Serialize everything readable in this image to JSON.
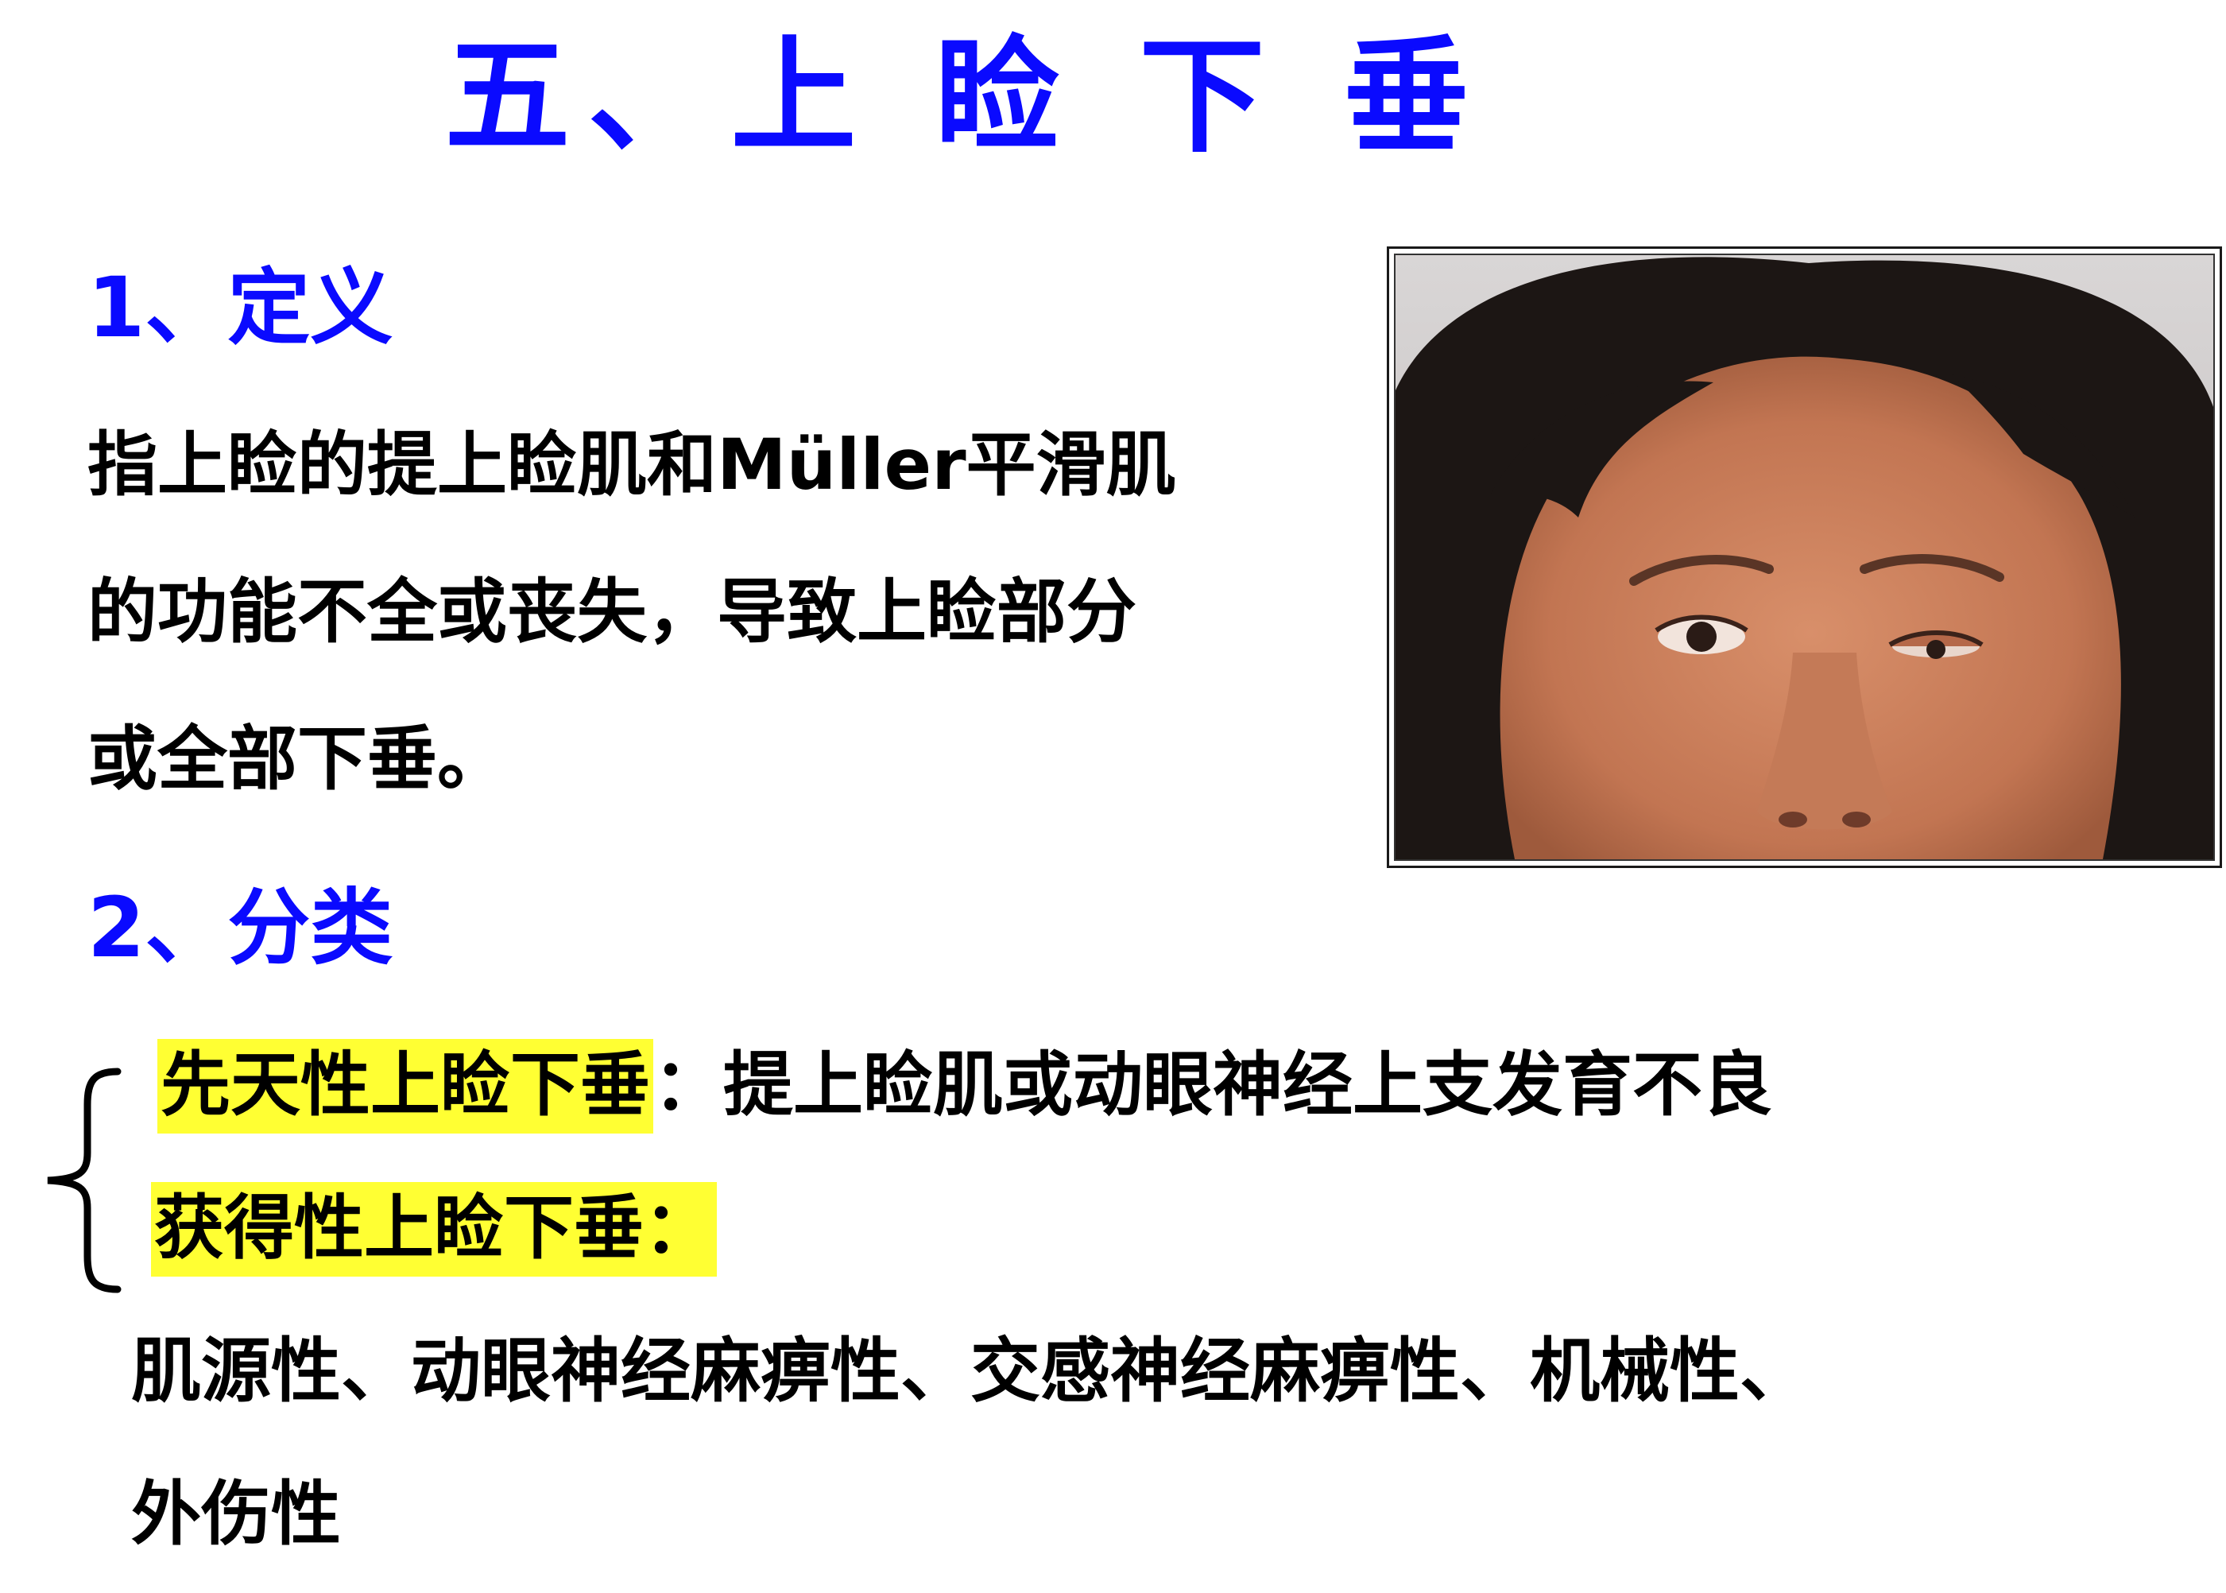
{
  "slide": {
    "title": "五、上 睑 下 垂",
    "colors": {
      "heading": "#0a0aff",
      "body": "#000000",
      "highlight": "#ffff33"
    },
    "section1": {
      "heading": "1、定义",
      "lines": [
        "指上睑的提上睑肌和Müller平滑肌",
        "的功能不全或丧失，导致上睑部分",
        "或全部下垂。"
      ]
    },
    "section2": {
      "heading": "2、分类",
      "congenital": {
        "label": "先天性上睑下垂",
        "colon": "：",
        "desc": "提上睑肌或动眼神经上支发育不良"
      },
      "acquired": {
        "label": "获得性上睑下垂",
        "colon": "："
      },
      "causes_line1": "肌源性、动眼神经麻痹性、交感神经麻痹性、机械性、",
      "causes_line2": "外伤性"
    },
    "photo": {
      "subject": "face-photo-ptosis"
    }
  }
}
